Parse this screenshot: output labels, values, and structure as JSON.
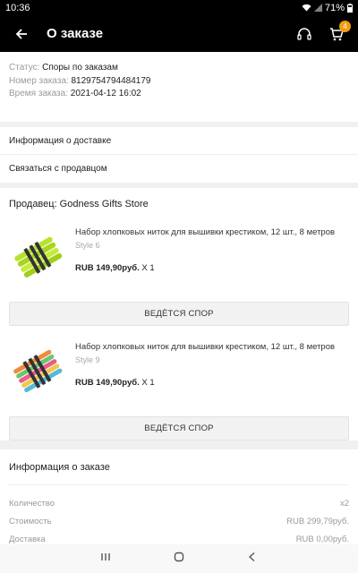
{
  "status_bar": {
    "time": "10:36",
    "battery": "71%"
  },
  "header": {
    "title": "О заказе",
    "cart_count": "4"
  },
  "order_info": {
    "status_label": "Статус:",
    "status_value": "Споры по заказам",
    "number_label": "Номер заказа:",
    "number_value": "8129754794484179",
    "time_label": "Время заказа:",
    "time_value": "2021-04-12 16:02"
  },
  "links": {
    "delivery": "Информация о доставке",
    "contact": "Связаться с продавцом"
  },
  "seller": {
    "label": "Продавец: Godness Gifts Store",
    "products": [
      {
        "name": "Набор хлопковых ниток для вышивки крестиком, 12 шт., 8 метров",
        "style": "Style 6",
        "price": "RUB 149,90руб.",
        "qty": "X 1",
        "button": "ВЕДЁТСЯ СПОР"
      },
      {
        "name": "Набор хлопковых ниток для вышивки крестиком, 12 шт., 8 метров",
        "style": "Style 9",
        "price": "RUB 149,90руб.",
        "qty": "X 1",
        "button": "ВЕДЁТСЯ СПОР"
      }
    ]
  },
  "summary": {
    "title": "Информация о заказе",
    "rows": [
      {
        "label": "Количество",
        "value": "x2"
      },
      {
        "label": "Стоимость",
        "value": "RUB 299,79руб."
      },
      {
        "label": "Доставка",
        "value": "RUB 0,00руб."
      }
    ]
  },
  "icons": {
    "back": "arrow-back-icon",
    "support": "headset-icon",
    "cart": "cart-icon",
    "nav_recent": "recent-apps-icon",
    "nav_home": "home-icon",
    "nav_back": "nav-back-icon"
  },
  "colors": {
    "header_bg": "#000000",
    "badge": "#f39c12",
    "page_bg": "#f0f0f0"
  }
}
